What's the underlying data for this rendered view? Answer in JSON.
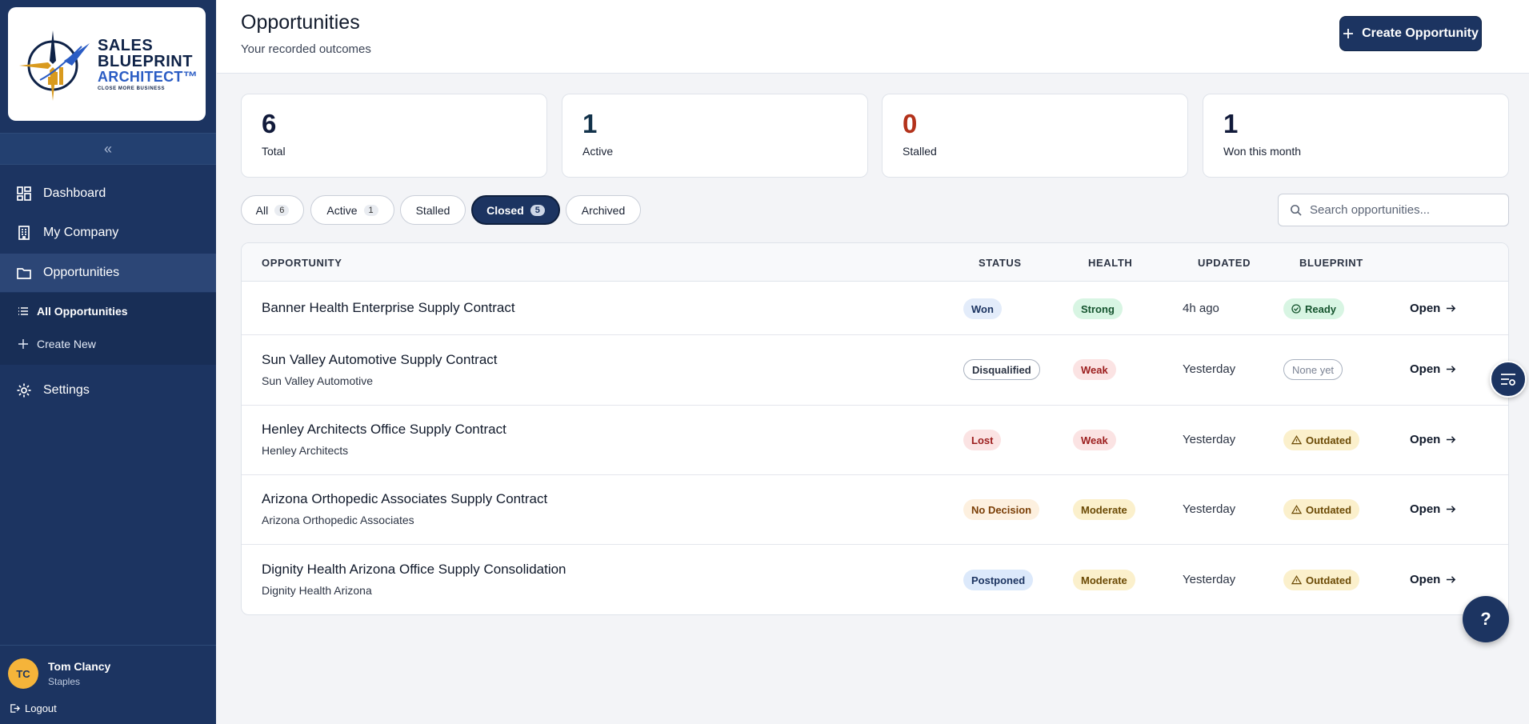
{
  "brand": {
    "line1": "SALES",
    "line2": "BLUEPRINT",
    "line3": "ARCHITECT™",
    "tagline": "CLOSE MORE BUSINESS"
  },
  "sidebar": {
    "collapse_icon": "«",
    "items": [
      {
        "label": "Dashboard",
        "icon": "dashboard-icon"
      },
      {
        "label": "My Company",
        "icon": "building-icon"
      },
      {
        "label": "Opportunities",
        "icon": "folder-icon"
      },
      {
        "label": "Settings",
        "icon": "gear-icon"
      }
    ],
    "subitems": [
      {
        "label": "All Opportunities",
        "icon": "list-icon"
      },
      {
        "label": "Create New",
        "icon": "plus-icon"
      }
    ]
  },
  "user": {
    "initials": "TC",
    "name": "Tom Clancy",
    "company": "Staples",
    "logout": "Logout"
  },
  "header": {
    "title": "Opportunities",
    "subtitle": "Your recorded outcomes",
    "create_label": "Create Opportunity"
  },
  "stats": [
    {
      "value": "6",
      "label": "Total",
      "color": "#111a3a"
    },
    {
      "value": "1",
      "label": "Active",
      "color": "#12324a"
    },
    {
      "value": "0",
      "label": "Stalled",
      "color": "#b3321b"
    },
    {
      "value": "1",
      "label": "Won this month",
      "color": "#111a3a"
    }
  ],
  "filters": [
    {
      "label": "All",
      "count": "6"
    },
    {
      "label": "Active",
      "count": "1"
    },
    {
      "label": "Stalled"
    },
    {
      "label": "Closed",
      "count": "5",
      "active": true
    },
    {
      "label": "Archived"
    }
  ],
  "search": {
    "placeholder": "Search opportunities..."
  },
  "table": {
    "headers": [
      "OPPORTUNITY",
      "STATUS",
      "HEALTH",
      "UPDATED",
      "BLUEPRINT"
    ],
    "open_label": "Open",
    "rows": [
      {
        "title": "Banner Health Enterprise Supply Contract",
        "subtitle": "",
        "status": "Won",
        "health": "Strong",
        "updated": "4h ago",
        "blueprint": "Ready"
      },
      {
        "title": "Sun Valley Automotive Supply Contract",
        "subtitle": "Sun Valley Automotive",
        "status": "Disqualified",
        "health": "Weak",
        "updated": "Yesterday",
        "blueprint": "None yet"
      },
      {
        "title": "Henley Architects Office Supply Contract",
        "subtitle": "Henley Architects",
        "status": "Lost",
        "health": "Weak",
        "updated": "Yesterday",
        "blueprint": "Outdated"
      },
      {
        "title": "Arizona Orthopedic Associates Supply Contract",
        "subtitle": "Arizona Orthopedic Associates",
        "status": "No Decision",
        "health": "Moderate",
        "updated": "Yesterday",
        "blueprint": "Outdated"
      },
      {
        "title": "Dignity Health Arizona Office Supply Consolidation",
        "subtitle": "Dignity Health Arizona",
        "status": "Postponed",
        "health": "Moderate",
        "updated": "Yesterday",
        "blueprint": "Outdated"
      }
    ]
  },
  "help_label": "?"
}
